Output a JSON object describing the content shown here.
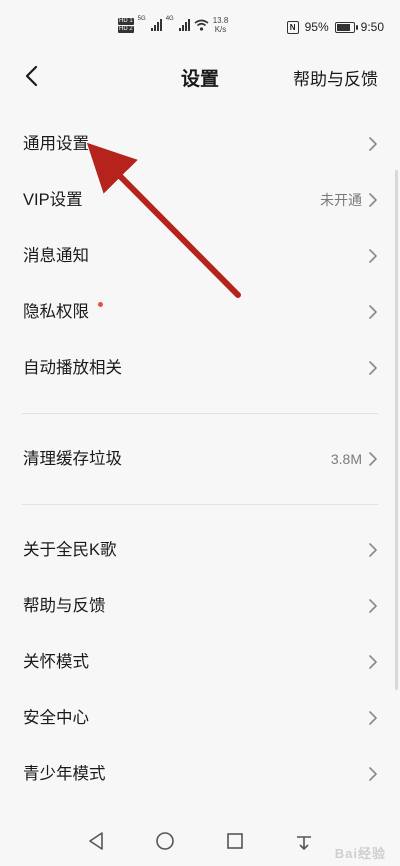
{
  "status_bar": {
    "hd_top": "HD 1",
    "hd_bottom": "HD 2",
    "signal1_label": "5G",
    "signal2_label": "4G",
    "net_speed": "13.8",
    "net_speed_unit": "K/s",
    "nfc": "N",
    "battery": "95%",
    "battery_level": 0.95,
    "time": "9:50"
  },
  "header": {
    "title": "设置",
    "help_link": "帮助与反馈"
  },
  "groups": [
    {
      "items": [
        {
          "label": "通用设置",
          "value": ""
        },
        {
          "label": "VIP设置",
          "value": "未开通"
        },
        {
          "label": "消息通知",
          "value": ""
        },
        {
          "label": "隐私权限",
          "value": "",
          "dot": true
        },
        {
          "label": "自动播放相关",
          "value": ""
        }
      ]
    },
    {
      "items": [
        {
          "label": "清理缓存垃圾",
          "value": "3.8M"
        }
      ]
    },
    {
      "items": [
        {
          "label": "关于全民K歌",
          "value": ""
        },
        {
          "label": "帮助与反馈",
          "value": ""
        },
        {
          "label": "关怀模式",
          "value": ""
        },
        {
          "label": "安全中心",
          "value": ""
        },
        {
          "label": "青少年模式",
          "value": ""
        }
      ]
    }
  ],
  "colors": {
    "annotation_arrow": "#b5231c",
    "dot": "#e8513a",
    "background": "#f7f7f7"
  },
  "watermark": "Bai经验"
}
